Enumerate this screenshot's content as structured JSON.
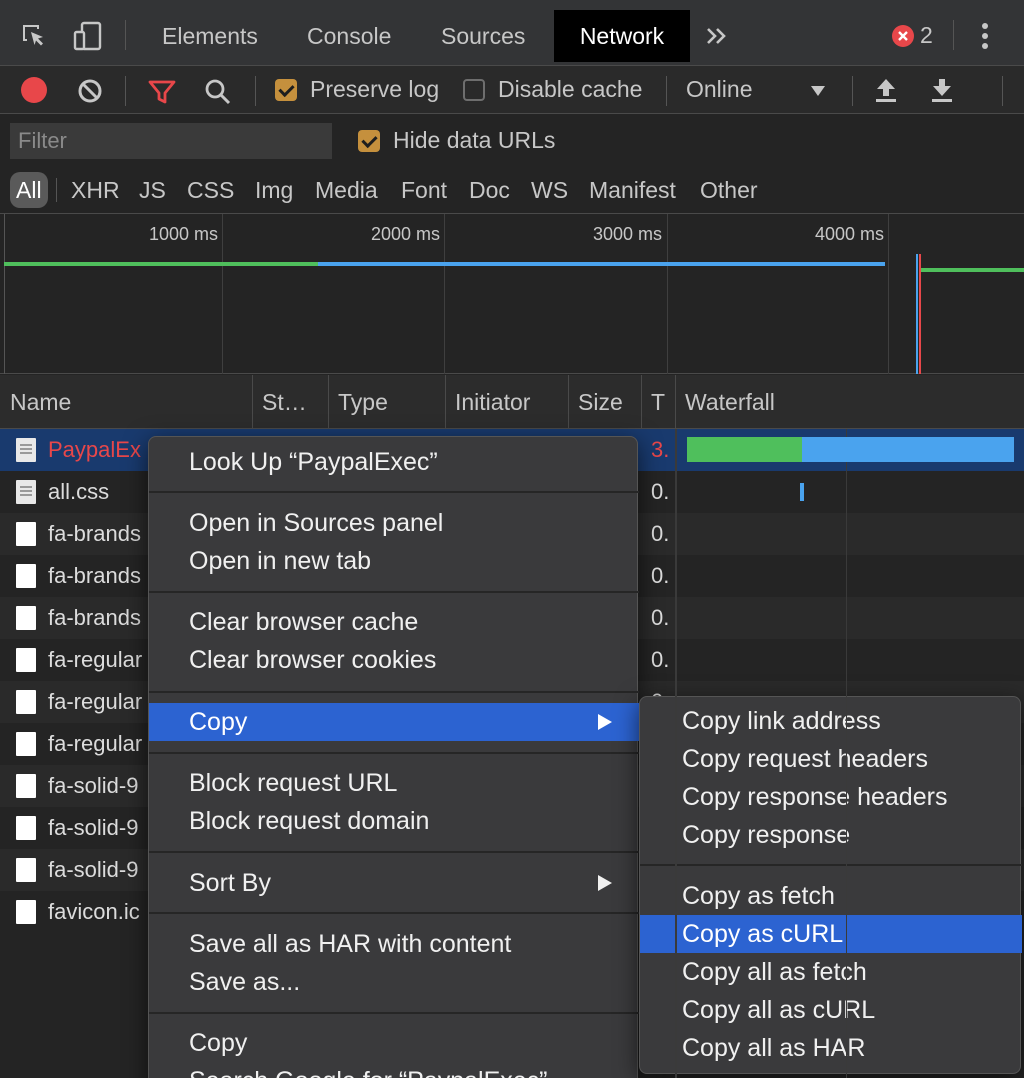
{
  "tabs": [
    {
      "label": "Elements"
    },
    {
      "label": "Console"
    },
    {
      "label": "Sources"
    },
    {
      "label": "Network"
    }
  ],
  "more_tabs_icon": "double-chevron-right",
  "error_count": "2",
  "toolbar": {
    "preserve_log_label": "Preserve log",
    "preserve_log_checked": true,
    "disable_cache_label": "Disable cache",
    "disable_cache_checked": false,
    "throttling_value": "Online"
  },
  "filter": {
    "placeholder": "Filter",
    "hide_data_urls_label": "Hide data URLs",
    "hide_data_urls_checked": true
  },
  "type_filters": [
    "All",
    "XHR",
    "JS",
    "CSS",
    "Img",
    "Media",
    "Font",
    "Doc",
    "WS",
    "Manifest",
    "Other"
  ],
  "overview": {
    "ticks": [
      "1000 ms",
      "2000 ms",
      "3000 ms",
      "4000 ms"
    ]
  },
  "table": {
    "columns": [
      "Name",
      "St…",
      "Type",
      "Initiator",
      "Size",
      "T",
      "Waterfall"
    ],
    "rows": [
      {
        "name": "PaypalEx",
        "time": "3.",
        "selected": true
      },
      {
        "name": "all.css",
        "time": "0."
      },
      {
        "name": "fa-brands",
        "time": "0."
      },
      {
        "name": "fa-brands",
        "time": "0."
      },
      {
        "name": "fa-brands",
        "time": "0."
      },
      {
        "name": "fa-regular",
        "time": "0."
      },
      {
        "name": "fa-regular",
        "time": "0"
      },
      {
        "name": "fa-regular",
        "time": ""
      },
      {
        "name": "fa-solid-9",
        "time": ""
      },
      {
        "name": "fa-solid-9",
        "time": ""
      },
      {
        "name": "fa-solid-9",
        "time": ""
      },
      {
        "name": "favicon.ic",
        "time": ""
      }
    ]
  },
  "context_menu": {
    "items": [
      "Look Up “PaypalExec”",
      "Open in Sources panel",
      "Open in new tab",
      "Clear browser cache",
      "Clear browser cookies",
      "Copy",
      "Block request URL",
      "Block request domain",
      "Sort By",
      "Save all as HAR with content",
      "Save as...",
      "Copy",
      "Search Google for “PaypalExec”"
    ]
  },
  "copy_submenu": {
    "items": [
      "Copy link address",
      "Copy request headers",
      "Copy response headers",
      "Copy response",
      "Copy as fetch",
      "Copy as cURL",
      "Copy all as fetch",
      "Copy all as cURL",
      "Copy all as HAR"
    ],
    "highlighted": "Copy as cURL"
  },
  "colors": {
    "accent_blue": "#2c63d1",
    "record_red": "#e8474a",
    "filter_red": "#e8474a",
    "checkbox_orange": "#c5903d",
    "waterfall_green": "#4fbf5c",
    "waterfall_blue": "#4aa3ee"
  }
}
